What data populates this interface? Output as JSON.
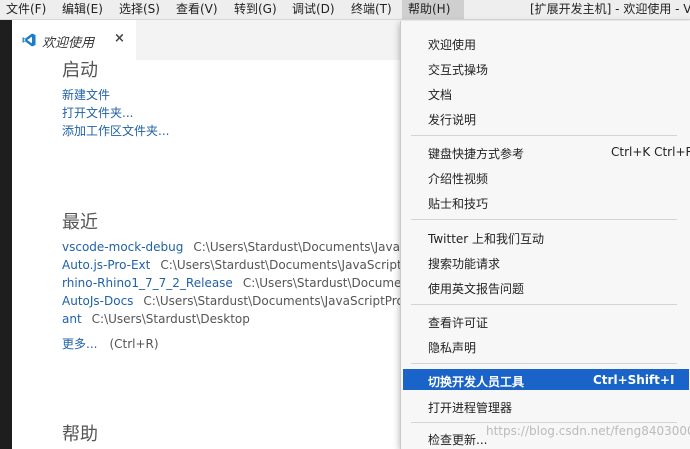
{
  "menubar": {
    "items": [
      "文件(F)",
      "编辑(E)",
      "选择(S)",
      "查看(V)",
      "转到(G)",
      "调试(D)",
      "终端(T)",
      "帮助(H)"
    ],
    "window_title": "[扩展开发主机] - 欢迎使用 - Vs"
  },
  "tab": {
    "label": "欢迎使用",
    "close": "×"
  },
  "welcome": {
    "start": {
      "heading": "启动",
      "links": [
        "新建文件",
        "打开文件夹...",
        "添加工作区文件夹..."
      ]
    },
    "recent": {
      "heading": "最近",
      "items": [
        {
          "name": "vscode-mock-debug",
          "path": "C:\\Users\\Stardust\\Documents\\JavaSc"
        },
        {
          "name": "Auto.js-Pro-Ext",
          "path": "C:\\Users\\Stardust\\Documents\\JavaScriptP"
        },
        {
          "name": "rhino-Rhino1_7_7_2_Release",
          "path": "C:\\Users\\Stardust\\Document"
        },
        {
          "name": "AutoJs-Docs",
          "path": "C:\\Users\\Stardust\\Documents\\JavaScriptProj"
        },
        {
          "name": "ant",
          "path": "C:\\Users\\Stardust\\Desktop"
        }
      ],
      "more": "更多...",
      "more_hint": "(Ctrl+R)"
    },
    "help": {
      "heading": "帮助"
    }
  },
  "help_menu": {
    "groups": [
      [
        {
          "label": "欢迎使用"
        },
        {
          "label": "交互式操场"
        },
        {
          "label": "文档"
        },
        {
          "label": "发行说明"
        }
      ],
      [
        {
          "label": "键盘快捷方式参考",
          "shortcut": "Ctrl+K Ctrl+R"
        },
        {
          "label": "介绍性视频"
        },
        {
          "label": "贴士和技巧"
        }
      ],
      [
        {
          "label": "Twitter 上和我们互动"
        },
        {
          "label": "搜索功能请求"
        },
        {
          "label": "使用英文报告问题"
        }
      ],
      [
        {
          "label": "查看许可证"
        },
        {
          "label": "隐私声明"
        }
      ],
      [
        {
          "label": "切换开发人员工具",
          "shortcut": "Ctrl+Shift+I",
          "selected": true
        },
        {
          "label": "打开进程管理器"
        }
      ],
      [
        {
          "label": "检查更新..."
        }
      ]
    ]
  },
  "watermark": "https://blog.csdn.net/feng8403000",
  "colors": {
    "highlight": "#1a63c8",
    "link": "#2062a6",
    "vscode_blue": "#1a7bc8"
  }
}
